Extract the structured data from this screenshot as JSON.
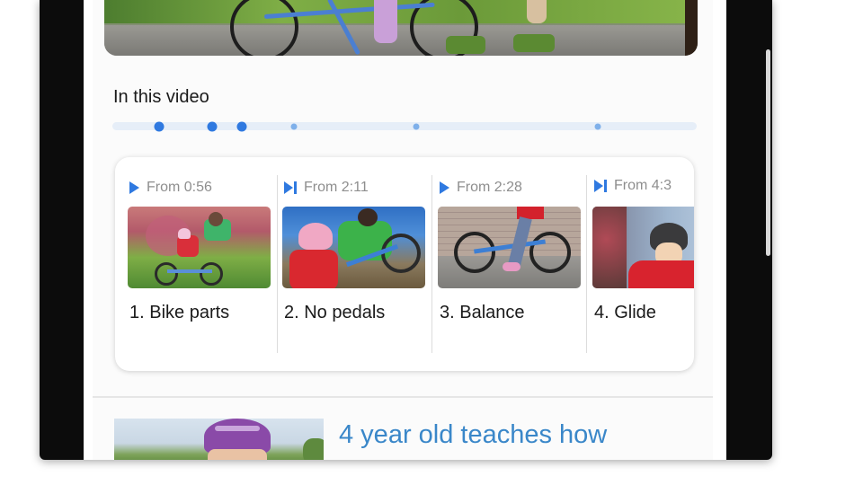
{
  "section": {
    "title": "In this video"
  },
  "timeline": {
    "markers": [
      0.08,
      0.17,
      0.222,
      0.31,
      0.52,
      0.83
    ]
  },
  "chapters": [
    {
      "from": "From 0:56",
      "label": "1. Bike parts",
      "icon": "play-icon"
    },
    {
      "from": "From 2:11",
      "label": "2. No pedals",
      "icon": "skip-icon"
    },
    {
      "from": "From 2:28",
      "label": "3. Balance",
      "icon": "play-icon"
    },
    {
      "from": "From 4:3",
      "label": "4. Glide",
      "icon": "skip-icon"
    }
  ],
  "next_video": {
    "title": "4 year old teaches how"
  },
  "colors": {
    "accent": "#2f79e0",
    "link": "#3a87c9"
  }
}
